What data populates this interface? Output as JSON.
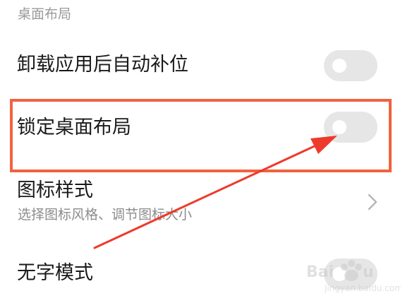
{
  "section": {
    "title": "桌面布局"
  },
  "rows": [
    {
      "label": "卸载应用后自动补位",
      "toggle_on": false
    },
    {
      "label": "锁定桌面布局",
      "toggle_on": false
    },
    {
      "label": "图标样式",
      "sublabel": "选择图标风格、调节图标大小"
    },
    {
      "label": "无字模式",
      "toggle_on": false
    }
  ],
  "icons": {
    "chevron": "chevron-right-icon"
  },
  "colors": {
    "highlight": "#f0633f",
    "arrow": "#ee3a2b",
    "toggle_off": "#e6e6e6",
    "text_primary": "#1a1a1a",
    "text_secondary": "#8c8c8c"
  },
  "watermark": {
    "text": "Baidu 经验"
  }
}
